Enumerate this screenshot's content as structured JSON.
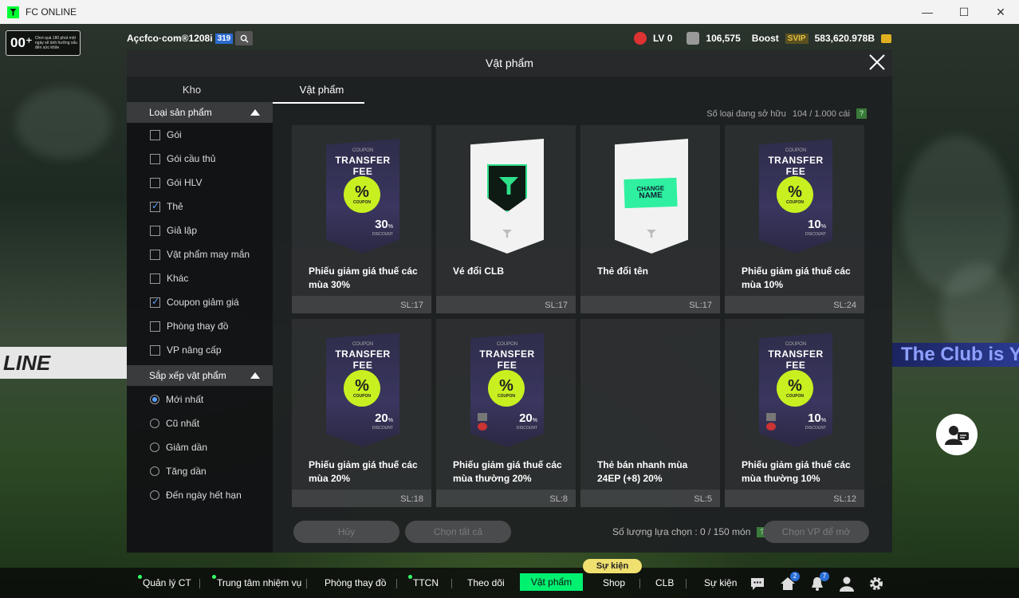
{
  "window": {
    "title": "FC ONLINE",
    "minimize": "—",
    "maximize": "☐",
    "close": "✕"
  },
  "hud": {
    "age_rating": "00⁺",
    "age_text": "Chơi quá 180 phút một ngày sẽ ảnh hưởng xấu đến sức khỏe",
    "username": "Açcfco·com®1208i",
    "user_level": "319",
    "lv_label": "LV 0",
    "mp_value": "106,575",
    "boost_label": "Boost",
    "svip_label": "SVIP",
    "bp_value": "583,620.978B",
    "bg_banner_right": "The Club is Y",
    "bg_banner_left": "LINE"
  },
  "modal": {
    "title": "Vật phẩm",
    "close": "✕",
    "tabs": [
      {
        "label": "Kho",
        "active": false
      },
      {
        "label": "Vật phẩm",
        "active": true
      }
    ],
    "owned_label": "Số loại đang sở hữu",
    "owned_value": "104 / 1.000 cái",
    "help": "?"
  },
  "sidebar": {
    "category_title": "Loại sản phẩm",
    "categories": [
      {
        "label": "Gói",
        "checked": false
      },
      {
        "label": "Gói cầu thủ",
        "checked": false
      },
      {
        "label": "Gói HLV",
        "checked": false
      },
      {
        "label": "Thẻ",
        "checked": true
      },
      {
        "label": "Giả lập",
        "checked": false
      },
      {
        "label": "Vật phẩm may mắn",
        "checked": false
      },
      {
        "label": "Khác",
        "checked": false
      },
      {
        "label": "Coupon giảm giá",
        "checked": true
      },
      {
        "label": "Phòng thay đồ",
        "checked": false
      },
      {
        "label": "VP nâng cấp",
        "checked": false
      }
    ],
    "sort_title": "Sắp xếp vật phẩm",
    "sorts": [
      {
        "label": "Mới nhất",
        "selected": true
      },
      {
        "label": "Cũ nhất",
        "selected": false
      },
      {
        "label": "Giảm dần",
        "selected": false
      },
      {
        "label": "Tăng dần",
        "selected": false
      },
      {
        "label": "Đến ngày hết hạn",
        "selected": false
      }
    ]
  },
  "items": [
    {
      "name": "Phiếu giảm giá thuế các mùa 30%",
      "qty": "SL:17",
      "type": "coupon",
      "coupon_top": "COUPON",
      "coupon_title": "TRANSFER FEE",
      "coupon_badge": "%",
      "coupon_badge_small": "COUPON",
      "discount": "30",
      "discount_unit": "%",
      "discount_label": "DISCOUNT",
      "locked": false
    },
    {
      "name": "Vé đổi CLB",
      "qty": "SL:17",
      "type": "club"
    },
    {
      "name": "Thẻ đổi tên",
      "qty": "SL:17",
      "type": "rename",
      "card_line1": "CHANGE",
      "card_line2": "NAME"
    },
    {
      "name": "Phiếu giảm giá thuế các mùa 10%",
      "qty": "SL:24",
      "type": "coupon",
      "coupon_top": "COUPON",
      "coupon_title": "TRANSFER FEE",
      "coupon_badge": "%",
      "coupon_badge_small": "COUPON",
      "discount": "10",
      "discount_unit": "%",
      "discount_label": "DISCOUNT",
      "locked": false
    },
    {
      "name": "Phiếu giảm giá thuế các mùa 20%",
      "qty": "SL:18",
      "type": "coupon",
      "coupon_top": "COUPON",
      "coupon_title": "TRANSFER FEE",
      "coupon_badge": "%",
      "coupon_badge_small": "COUPON",
      "discount": "20",
      "discount_unit": "%",
      "discount_label": "DISCOUNT",
      "locked": false
    },
    {
      "name": "Phiếu giảm giá thuế các mùa thường 20%",
      "qty": "SL:8",
      "type": "coupon",
      "coupon_top": "COUPON",
      "coupon_title": "TRANSFER FEE",
      "coupon_badge": "%",
      "coupon_badge_small": "COUPON",
      "discount": "20",
      "discount_unit": "%",
      "discount_label": "DISCOUNT",
      "locked": true
    },
    {
      "name": "Thẻ bán nhanh mùa 24EP (+8) 20%",
      "qty": "SL:5",
      "type": "empty"
    },
    {
      "name": "Phiếu giảm giá thuế các mùa thường 10%",
      "qty": "SL:12",
      "type": "coupon",
      "coupon_top": "COUPON",
      "coupon_title": "TRANSFER FEE",
      "coupon_badge": "%",
      "coupon_badge_small": "COUPON",
      "discount": "10",
      "discount_unit": "%",
      "discount_label": "DISCOUNT",
      "locked": true
    }
  ],
  "footer": {
    "cancel": "Hủy",
    "select_all": "Chọn tất cả",
    "select_count_label": "Số lượng lựa chọn : 0 / 150 món",
    "select_vp": "Chọn VP để mở"
  },
  "bottom_nav": {
    "items": [
      {
        "label": "Quản lý CT",
        "dot": true
      },
      {
        "label": "Trung tâm nhiệm vụ",
        "dot": true
      },
      {
        "label": "Phòng thay đồ",
        "dot": false
      },
      {
        "label": "TTCN",
        "dot": true
      },
      {
        "label": "Theo dõi",
        "dot": false
      },
      {
        "label": "Vật phẩm",
        "active": true
      },
      {
        "label": "Shop",
        "dot": false
      },
      {
        "label": "CLB",
        "dot": false
      },
      {
        "label": "Sự kiện",
        "dot": false
      }
    ],
    "event_tag": "Sự kiện",
    "home_badge": "2",
    "bell_badge": "7"
  },
  "colors": {
    "accent_green": "#00f070",
    "checkbox_check": "#5aa0ff",
    "coupon_badge": "#c8f020"
  }
}
